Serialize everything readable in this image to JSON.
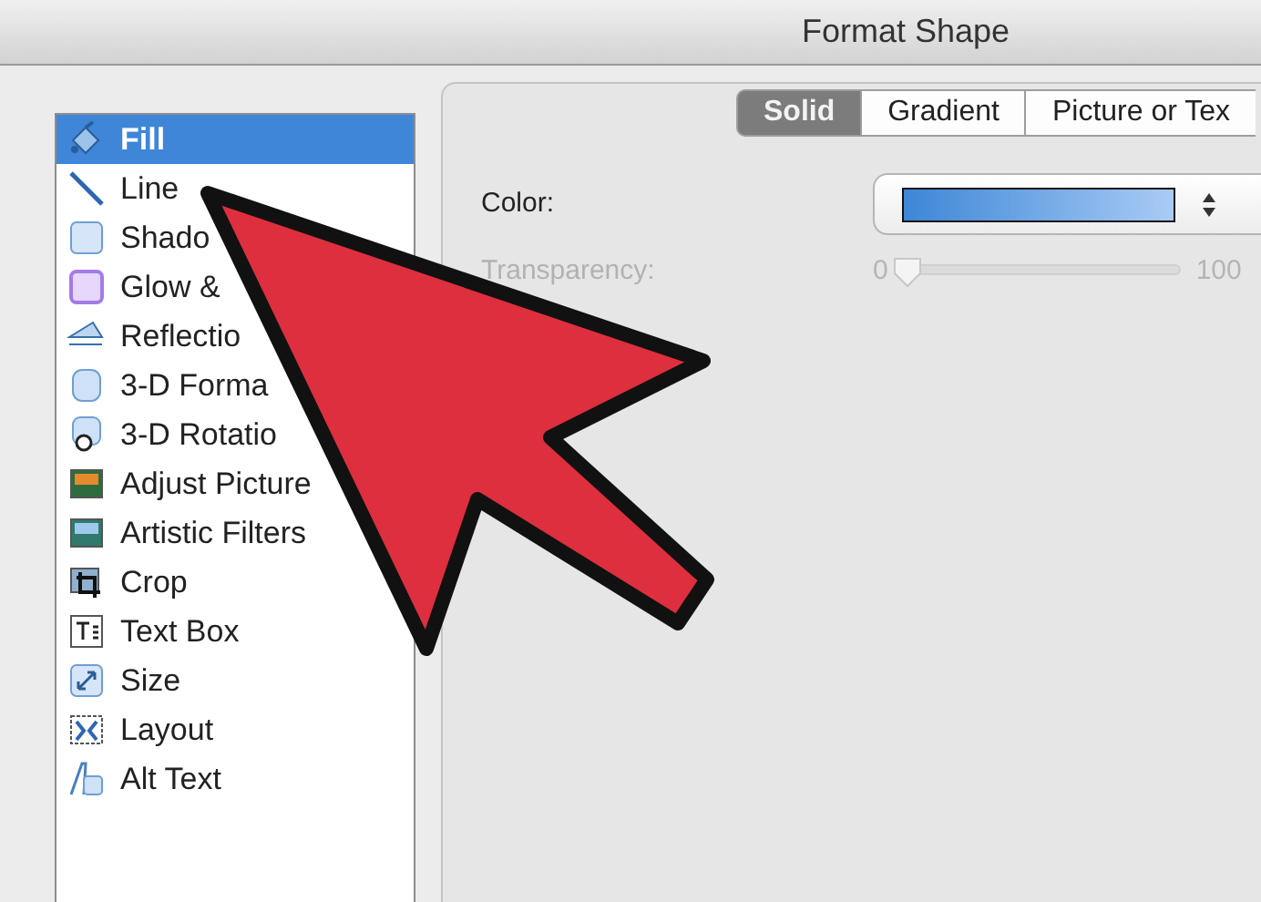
{
  "window": {
    "title": "Format Shape"
  },
  "sidebar": {
    "items": [
      {
        "label": "Fill",
        "selected": true
      },
      {
        "label": "Line",
        "selected": false
      },
      {
        "label": "Shado",
        "selected": false
      },
      {
        "label": "Glow &",
        "selected": false
      },
      {
        "label": "Reflectio",
        "selected": false
      },
      {
        "label": "3-D Forma",
        "selected": false
      },
      {
        "label": "3-D Rotatio",
        "selected": false
      },
      {
        "label": "Adjust Picture",
        "selected": false
      },
      {
        "label": "Artistic Filters",
        "selected": false
      },
      {
        "label": "Crop",
        "selected": false
      },
      {
        "label": "Text Box",
        "selected": false
      },
      {
        "label": "Size",
        "selected": false
      },
      {
        "label": "Layout",
        "selected": false
      },
      {
        "label": "Alt Text",
        "selected": false
      }
    ]
  },
  "fill_tabs": [
    {
      "label": "Solid",
      "selected": true
    },
    {
      "label": "Gradient",
      "selected": false
    },
    {
      "label": "Picture or Tex",
      "selected": false
    }
  ],
  "color": {
    "label": "Color:"
  },
  "transparency": {
    "label": "Transparency:",
    "disabled": true,
    "level": 0,
    "min_label": "0",
    "max_label": "100"
  }
}
